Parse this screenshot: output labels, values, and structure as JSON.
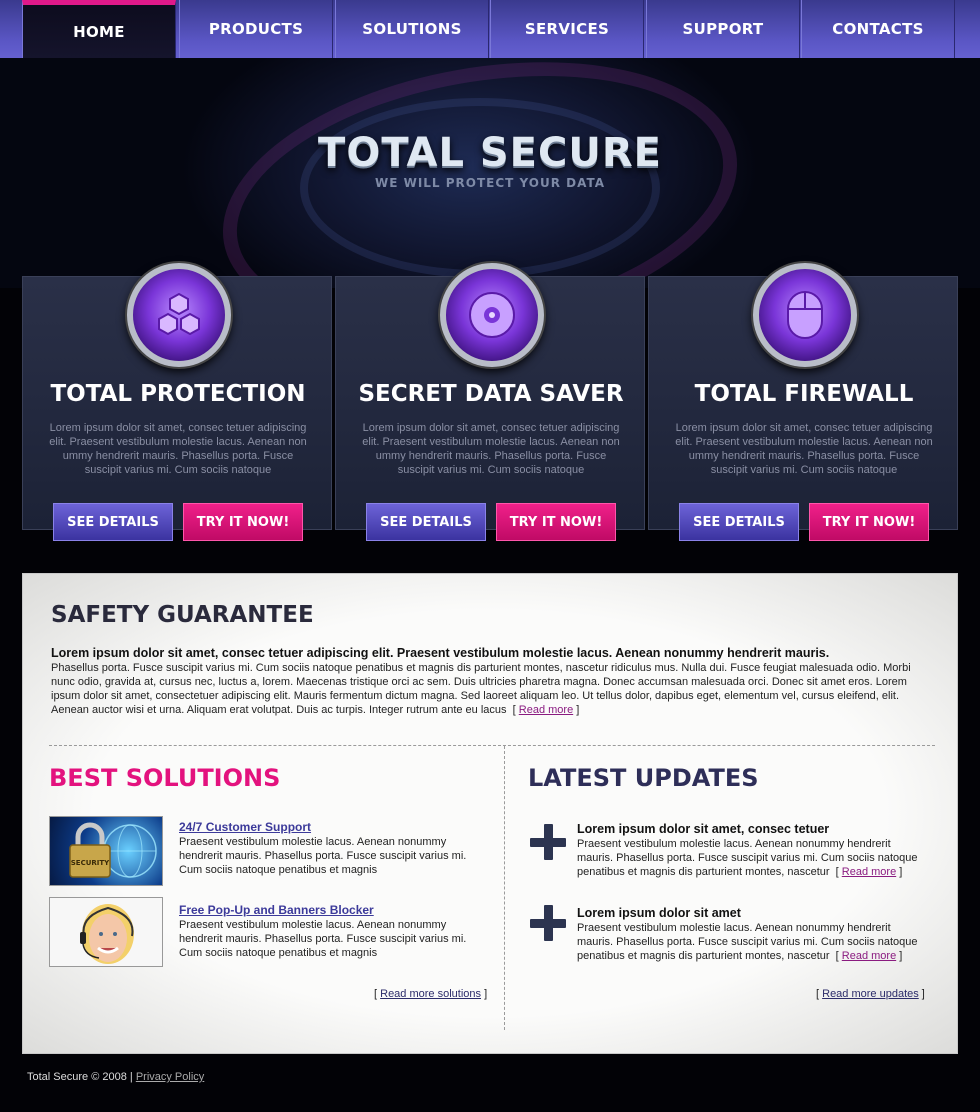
{
  "nav": {
    "items": [
      {
        "label": "HOME"
      },
      {
        "label": "PRODUCTS"
      },
      {
        "label": "SOLUTIONS"
      },
      {
        "label": "SERVICES"
      },
      {
        "label": "SUPPORT"
      },
      {
        "label": "CONTACTS"
      }
    ],
    "active": "HOME"
  },
  "hero": {
    "title": "TOTAL SECURE",
    "subtitle": "WE WILL PROTECT YOUR DATA"
  },
  "features": [
    {
      "icon": "hexagon-cluster-icon",
      "title": "TOTAL PROTECTION",
      "text": "Lorem ipsum dolor sit amet, consec tetuer adipiscing elit. Praesent vestibulum molestie lacus. Aenean non ummy hendrerit mauris. Phasellus porta. Fusce suscipit varius mi. Cum sociis natoque",
      "details_label": "SEE DETAILS",
      "try_label": "TRY IT NOW!"
    },
    {
      "icon": "disc-icon",
      "title": "SECRET DATA SAVER",
      "text": "Lorem ipsum dolor sit amet, consec tetuer adipiscing elit. Praesent vestibulum molestie lacus. Aenean non ummy hendrerit mauris. Phasellus porta. Fusce suscipit varius mi. Cum sociis natoque",
      "details_label": "SEE DETAILS",
      "try_label": "TRY IT NOW!"
    },
    {
      "icon": "mouse-icon",
      "title": "TOTAL FIREWALL",
      "text": "Lorem ipsum dolor sit amet, consec tetuer adipiscing elit. Praesent vestibulum molestie lacus. Aenean non ummy hendrerit mauris. Phasellus porta. Fusce suscipit varius mi. Cum sociis natoque",
      "details_label": "SEE DETAILS",
      "try_label": "TRY IT NOW!"
    }
  ],
  "safety": {
    "title": "SAFETY GUARANTEE",
    "lead": "Lorem ipsum dolor sit amet, consec tetuer adipiscing elit. Praesent vestibulum molestie lacus. Aenean nonummy hendrerit mauris.",
    "body": "Phasellus porta. Fusce suscipit varius mi. Cum sociis natoque penatibus et magnis dis parturient montes, nascetur ridiculus mus. Nulla dui. Fusce feugiat malesuada odio. Morbi nunc odio, gravida at, cursus nec, luctus a, lorem. Maecenas tristique orci ac sem. Duis ultricies pharetra magna. Donec accumsan malesuada orci. Donec sit amet eros. Lorem ipsum dolor sit amet, consectetuer adipiscing elit. Mauris fermentum dictum magna. Sed laoreet aliquam leo. Ut tellus dolor, dapibus eget, elementum vel, cursus eleifend, elit. Aenean auctor wisi et urna. Aliquam erat volutpat. Duis ac turpis. Integer rutrum ante eu lacus",
    "read_more": "Read more"
  },
  "best_solutions": {
    "title": "BEST SOLUTIONS",
    "items": [
      {
        "image_label": "SECURITY",
        "link": "24/7 Customer Support",
        "text": "Praesent vestibulum molestie lacus. Aenean nonummy hendrerit mauris. Phasellus porta. Fusce suscipit varius mi. Cum sociis natoque penatibus et magnis"
      },
      {
        "image_label": "",
        "link": "Free Pop-Up and Banners Blocker",
        "text": "Praesent vestibulum molestie lacus. Aenean nonummy hendrerit mauris. Phasellus porta. Fusce suscipit varius mi. Cum sociis natoque penatibus et magnis"
      }
    ],
    "read_more": "Read more solutions"
  },
  "latest_updates": {
    "title": "LATEST UPDATES",
    "items": [
      {
        "title": "Lorem ipsum dolor sit amet, consec tetuer",
        "text": "Praesent vestibulum molestie lacus. Aenean nonummy hendrerit mauris. Phasellus porta. Fusce suscipit varius mi. Cum sociis natoque penatibus et magnis dis parturient montes, nascetur",
        "read_more": "Read more"
      },
      {
        "title": "Lorem ipsum dolor sit amet",
        "text": "Praesent vestibulum molestie lacus. Aenean nonummy hendrerit mauris. Phasellus porta. Fusce suscipit varius mi. Cum sociis natoque penatibus et magnis dis parturient montes, nascetur",
        "read_more": "Read more"
      }
    ],
    "read_more": "Read more updates"
  },
  "footer": {
    "copyright": "Total Secure © 2008 |",
    "privacy": "Privacy Policy"
  },
  "colors": {
    "accent_pink": "#e3127e",
    "accent_purple": "#5a56c4",
    "heading_navy": "#2e2e58"
  }
}
